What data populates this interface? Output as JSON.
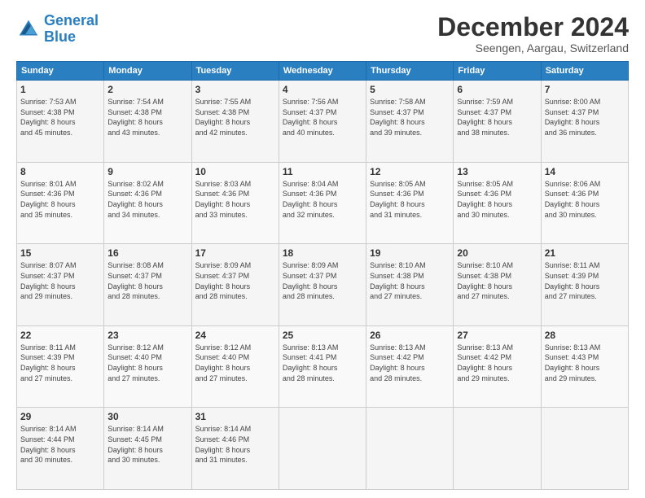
{
  "logo": {
    "line1": "General",
    "line2": "Blue"
  },
  "title": "December 2024",
  "subtitle": "Seengen, Aargau, Switzerland",
  "days_header": [
    "Sunday",
    "Monday",
    "Tuesday",
    "Wednesday",
    "Thursday",
    "Friday",
    "Saturday"
  ],
  "weeks": [
    [
      {
        "day": "1",
        "info": "Sunrise: 7:53 AM\nSunset: 4:38 PM\nDaylight: 8 hours\nand 45 minutes."
      },
      {
        "day": "2",
        "info": "Sunrise: 7:54 AM\nSunset: 4:38 PM\nDaylight: 8 hours\nand 43 minutes."
      },
      {
        "day": "3",
        "info": "Sunrise: 7:55 AM\nSunset: 4:38 PM\nDaylight: 8 hours\nand 42 minutes."
      },
      {
        "day": "4",
        "info": "Sunrise: 7:56 AM\nSunset: 4:37 PM\nDaylight: 8 hours\nand 40 minutes."
      },
      {
        "day": "5",
        "info": "Sunrise: 7:58 AM\nSunset: 4:37 PM\nDaylight: 8 hours\nand 39 minutes."
      },
      {
        "day": "6",
        "info": "Sunrise: 7:59 AM\nSunset: 4:37 PM\nDaylight: 8 hours\nand 38 minutes."
      },
      {
        "day": "7",
        "info": "Sunrise: 8:00 AM\nSunset: 4:37 PM\nDaylight: 8 hours\nand 36 minutes."
      }
    ],
    [
      {
        "day": "8",
        "info": "Sunrise: 8:01 AM\nSunset: 4:36 PM\nDaylight: 8 hours\nand 35 minutes."
      },
      {
        "day": "9",
        "info": "Sunrise: 8:02 AM\nSunset: 4:36 PM\nDaylight: 8 hours\nand 34 minutes."
      },
      {
        "day": "10",
        "info": "Sunrise: 8:03 AM\nSunset: 4:36 PM\nDaylight: 8 hours\nand 33 minutes."
      },
      {
        "day": "11",
        "info": "Sunrise: 8:04 AM\nSunset: 4:36 PM\nDaylight: 8 hours\nand 32 minutes."
      },
      {
        "day": "12",
        "info": "Sunrise: 8:05 AM\nSunset: 4:36 PM\nDaylight: 8 hours\nand 31 minutes."
      },
      {
        "day": "13",
        "info": "Sunrise: 8:05 AM\nSunset: 4:36 PM\nDaylight: 8 hours\nand 30 minutes."
      },
      {
        "day": "14",
        "info": "Sunrise: 8:06 AM\nSunset: 4:36 PM\nDaylight: 8 hours\nand 30 minutes."
      }
    ],
    [
      {
        "day": "15",
        "info": "Sunrise: 8:07 AM\nSunset: 4:37 PM\nDaylight: 8 hours\nand 29 minutes."
      },
      {
        "day": "16",
        "info": "Sunrise: 8:08 AM\nSunset: 4:37 PM\nDaylight: 8 hours\nand 28 minutes."
      },
      {
        "day": "17",
        "info": "Sunrise: 8:09 AM\nSunset: 4:37 PM\nDaylight: 8 hours\nand 28 minutes."
      },
      {
        "day": "18",
        "info": "Sunrise: 8:09 AM\nSunset: 4:37 PM\nDaylight: 8 hours\nand 28 minutes."
      },
      {
        "day": "19",
        "info": "Sunrise: 8:10 AM\nSunset: 4:38 PM\nDaylight: 8 hours\nand 27 minutes."
      },
      {
        "day": "20",
        "info": "Sunrise: 8:10 AM\nSunset: 4:38 PM\nDaylight: 8 hours\nand 27 minutes."
      },
      {
        "day": "21",
        "info": "Sunrise: 8:11 AM\nSunset: 4:39 PM\nDaylight: 8 hours\nand 27 minutes."
      }
    ],
    [
      {
        "day": "22",
        "info": "Sunrise: 8:11 AM\nSunset: 4:39 PM\nDaylight: 8 hours\nand 27 minutes."
      },
      {
        "day": "23",
        "info": "Sunrise: 8:12 AM\nSunset: 4:40 PM\nDaylight: 8 hours\nand 27 minutes."
      },
      {
        "day": "24",
        "info": "Sunrise: 8:12 AM\nSunset: 4:40 PM\nDaylight: 8 hours\nand 27 minutes."
      },
      {
        "day": "25",
        "info": "Sunrise: 8:13 AM\nSunset: 4:41 PM\nDaylight: 8 hours\nand 28 minutes."
      },
      {
        "day": "26",
        "info": "Sunrise: 8:13 AM\nSunset: 4:42 PM\nDaylight: 8 hours\nand 28 minutes."
      },
      {
        "day": "27",
        "info": "Sunrise: 8:13 AM\nSunset: 4:42 PM\nDaylight: 8 hours\nand 29 minutes."
      },
      {
        "day": "28",
        "info": "Sunrise: 8:13 AM\nSunset: 4:43 PM\nDaylight: 8 hours\nand 29 minutes."
      }
    ],
    [
      {
        "day": "29",
        "info": "Sunrise: 8:14 AM\nSunset: 4:44 PM\nDaylight: 8 hours\nand 30 minutes."
      },
      {
        "day": "30",
        "info": "Sunrise: 8:14 AM\nSunset: 4:45 PM\nDaylight: 8 hours\nand 30 minutes."
      },
      {
        "day": "31",
        "info": "Sunrise: 8:14 AM\nSunset: 4:46 PM\nDaylight: 8 hours\nand 31 minutes."
      },
      {
        "day": "",
        "info": ""
      },
      {
        "day": "",
        "info": ""
      },
      {
        "day": "",
        "info": ""
      },
      {
        "day": "",
        "info": ""
      }
    ]
  ]
}
